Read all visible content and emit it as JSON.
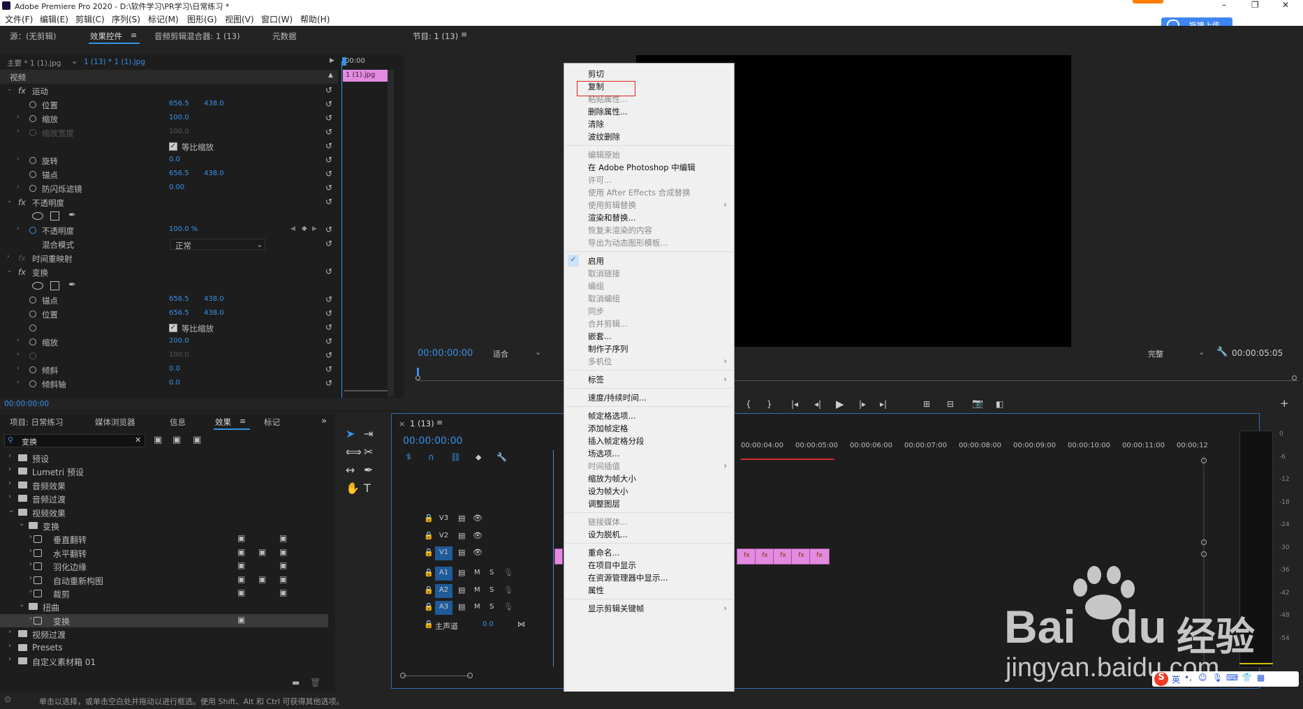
{
  "titlebar": {
    "title": "Adobe Premiere Pro 2020 - D:\\软件学习\\PR学习\\日常练习 *",
    "minimize": "–",
    "restore": "❐",
    "close": "✕"
  },
  "menubar": [
    "文件(F)",
    "编辑(E)",
    "剪辑(C)",
    "序列(S)",
    "标记(M)",
    "图形(G)",
    "视图(V)",
    "窗口(W)",
    "帮助(H)"
  ],
  "upload": {
    "label": "拖拽上传"
  },
  "top_left_tabs": {
    "source": "源：(无剪辑)",
    "effect_controls": "效果控件",
    "audio_mixer": "音频剪辑混合器: 1 (13)",
    "metadata": "元数据"
  },
  "ec": {
    "master": "主要 * 1 (1).jpg",
    "clip": "1 (13) * 1 (1).jpg",
    "timecode_head": "00:00",
    "clip_block": "1 (1).jpg",
    "video_label": "视频",
    "footer_tc": "00:00:00:00",
    "motion": "运动",
    "position": "位置",
    "pos_x": "656.5",
    "pos_y": "438.0",
    "scale": "缩放",
    "scale_val": "100.0",
    "scale_w": "缩放宽度",
    "scale_w_val": "100.0",
    "uniform": "等比缩放",
    "rotation": "旋转",
    "rot_val": "0.0",
    "anchor": "锚点",
    "anc_x": "656.5",
    "anc_y": "438.0",
    "flicker": "防闪烁滤镜",
    "flick_val": "0.00",
    "opacity": "不透明度",
    "opacity_prop": "不透明度",
    "opacity_val": "100.0 %",
    "blend": "混合模式",
    "blend_val": "正常",
    "time_remap": "时间重映射",
    "transform": "变换",
    "t_anchor": "锚点",
    "t_anc_x": "656.5",
    "t_anc_y": "438.0",
    "t_position": "位置",
    "t_pos_x": "656.5",
    "t_pos_y": "438.0",
    "t_uniform": "等比缩放",
    "t_scale": "缩放",
    "t_scale_val": "200.0",
    "t_scale_w_val": "100.0",
    "skew": "倾斜",
    "skew_val": "0.0",
    "skew_axis": "倾斜轴",
    "skew_axis_val": "0.0"
  },
  "program": {
    "title": "节目: 1 (13)",
    "tc": "00:00:00:00",
    "fit": "适合",
    "quality": "完整",
    "duration": "00:00:05:05"
  },
  "project_tabs": {
    "project": "项目: 日常练习",
    "media": "媒体浏览器",
    "info": "信息",
    "effects": "效果",
    "markers": "标记",
    "search": "变换"
  },
  "effects_tree": [
    {
      "label": "预设",
      "type": "folder",
      "level": 0
    },
    {
      "label": "Lumetri 预设",
      "type": "folder",
      "level": 0
    },
    {
      "label": "音频效果",
      "type": "folder",
      "level": 0
    },
    {
      "label": "音频过渡",
      "type": "folder",
      "level": 0
    },
    {
      "label": "视频效果",
      "type": "folder",
      "level": 0
    },
    {
      "label": "变换",
      "type": "folder",
      "level": 1
    },
    {
      "label": "垂直翻转",
      "type": "fx",
      "level": 2
    },
    {
      "label": "水平翻转",
      "type": "fx",
      "level": 2
    },
    {
      "label": "羽化边缘",
      "type": "fx",
      "level": 2
    },
    {
      "label": "自动重新构图",
      "type": "fx",
      "level": 2
    },
    {
      "label": "裁剪",
      "type": "fx",
      "level": 2
    },
    {
      "label": "扭曲",
      "type": "folder",
      "level": 1
    },
    {
      "label": "变换",
      "type": "fx",
      "level": 2
    },
    {
      "label": "视频过渡",
      "type": "folder",
      "level": 0
    },
    {
      "label": "Presets",
      "type": "folder",
      "level": 0
    },
    {
      "label": "自定义素材箱 01",
      "type": "folder",
      "level": 0
    }
  ],
  "timeline": {
    "title": "1 (13)",
    "tc": "00:00:00:00",
    "ticks": [
      "00:00:04:00",
      "00:00:05:00",
      "00:00:06:00",
      "00:00:07:00",
      "00:00:08:00",
      "00:00:09:00",
      "00:00:10:00",
      "00:00:11:00",
      "00:00:12"
    ],
    "tracks": [
      "V3",
      "V2",
      "V1",
      "A1",
      "A2",
      "A3"
    ],
    "master": "主声道",
    "master_val": "0.0",
    "m": "M",
    "s": "S",
    "fx": "fx"
  },
  "meter": [
    "0",
    "-6",
    "-12",
    "-18",
    "-24",
    "-30",
    "-36",
    "-42",
    "-48",
    "-54"
  ],
  "context_menu": [
    {
      "label": "剪切",
      "enabled": true
    },
    {
      "label": "复制",
      "enabled": true,
      "highlight": true
    },
    {
      "label": "粘贴属性...",
      "enabled": false
    },
    {
      "label": "删除属性...",
      "enabled": true
    },
    {
      "label": "清除",
      "enabled": true
    },
    {
      "label": "波纹删除",
      "enabled": true
    },
    {
      "sep": true
    },
    {
      "label": "编辑原始",
      "enabled": false
    },
    {
      "label": "在 Adobe Photoshop 中编辑",
      "enabled": true
    },
    {
      "label": "许可...",
      "enabled": false
    },
    {
      "label": "使用 After Effects 合成替换",
      "enabled": false
    },
    {
      "label": "使用剪辑替换",
      "enabled": false,
      "sub": true
    },
    {
      "label": "渲染和替换...",
      "enabled": true
    },
    {
      "label": "恢复未渲染的内容",
      "enabled": false
    },
    {
      "label": "导出为动态图形模板...",
      "enabled": false
    },
    {
      "sep": true
    },
    {
      "label": "启用",
      "enabled": true,
      "checked": true
    },
    {
      "label": "取消链接",
      "enabled": false
    },
    {
      "label": "编组",
      "enabled": false
    },
    {
      "label": "取消编组",
      "enabled": false
    },
    {
      "label": "同步",
      "enabled": false
    },
    {
      "label": "合并剪辑...",
      "enabled": false
    },
    {
      "label": "嵌套...",
      "enabled": true
    },
    {
      "label": "制作子序列",
      "enabled": true
    },
    {
      "label": "多机位",
      "enabled": false,
      "sub": true
    },
    {
      "sep": true
    },
    {
      "label": "标签",
      "enabled": true,
      "sub": true
    },
    {
      "sep": true
    },
    {
      "label": "速度/持续时间...",
      "enabled": true
    },
    {
      "sep": true
    },
    {
      "label": "帧定格选项...",
      "enabled": true
    },
    {
      "label": "添加帧定格",
      "enabled": true
    },
    {
      "label": "插入帧定格分段",
      "enabled": true
    },
    {
      "label": "场选项...",
      "enabled": true
    },
    {
      "label": "时间插值",
      "enabled": false,
      "sub": true
    },
    {
      "label": "缩放为帧大小",
      "enabled": true
    },
    {
      "label": "设为帧大小",
      "enabled": true
    },
    {
      "label": "调整图层",
      "enabled": true
    },
    {
      "sep": true
    },
    {
      "label": "链接媒体...",
      "enabled": false
    },
    {
      "label": "设为脱机...",
      "enabled": true
    },
    {
      "sep": true
    },
    {
      "label": "重命名...",
      "enabled": true
    },
    {
      "label": "在项目中显示",
      "enabled": true
    },
    {
      "label": "在资源管理器中显示...",
      "enabled": true
    },
    {
      "label": "属性",
      "enabled": true
    },
    {
      "sep": true
    },
    {
      "label": "显示剪辑关键帧",
      "enabled": true,
      "sub": true
    }
  ],
  "status": "单击以选择，或单击空白处并拖动以进行框选。使用 Shift、Alt 和 Ctrl 可获得其他选项。",
  "watermark": {
    "brand": "Bai",
    "brand2": "du",
    "cn": "经验",
    "url": "jingyan.baidu.com"
  },
  "ime": {
    "s": "S",
    "lang": "英"
  }
}
